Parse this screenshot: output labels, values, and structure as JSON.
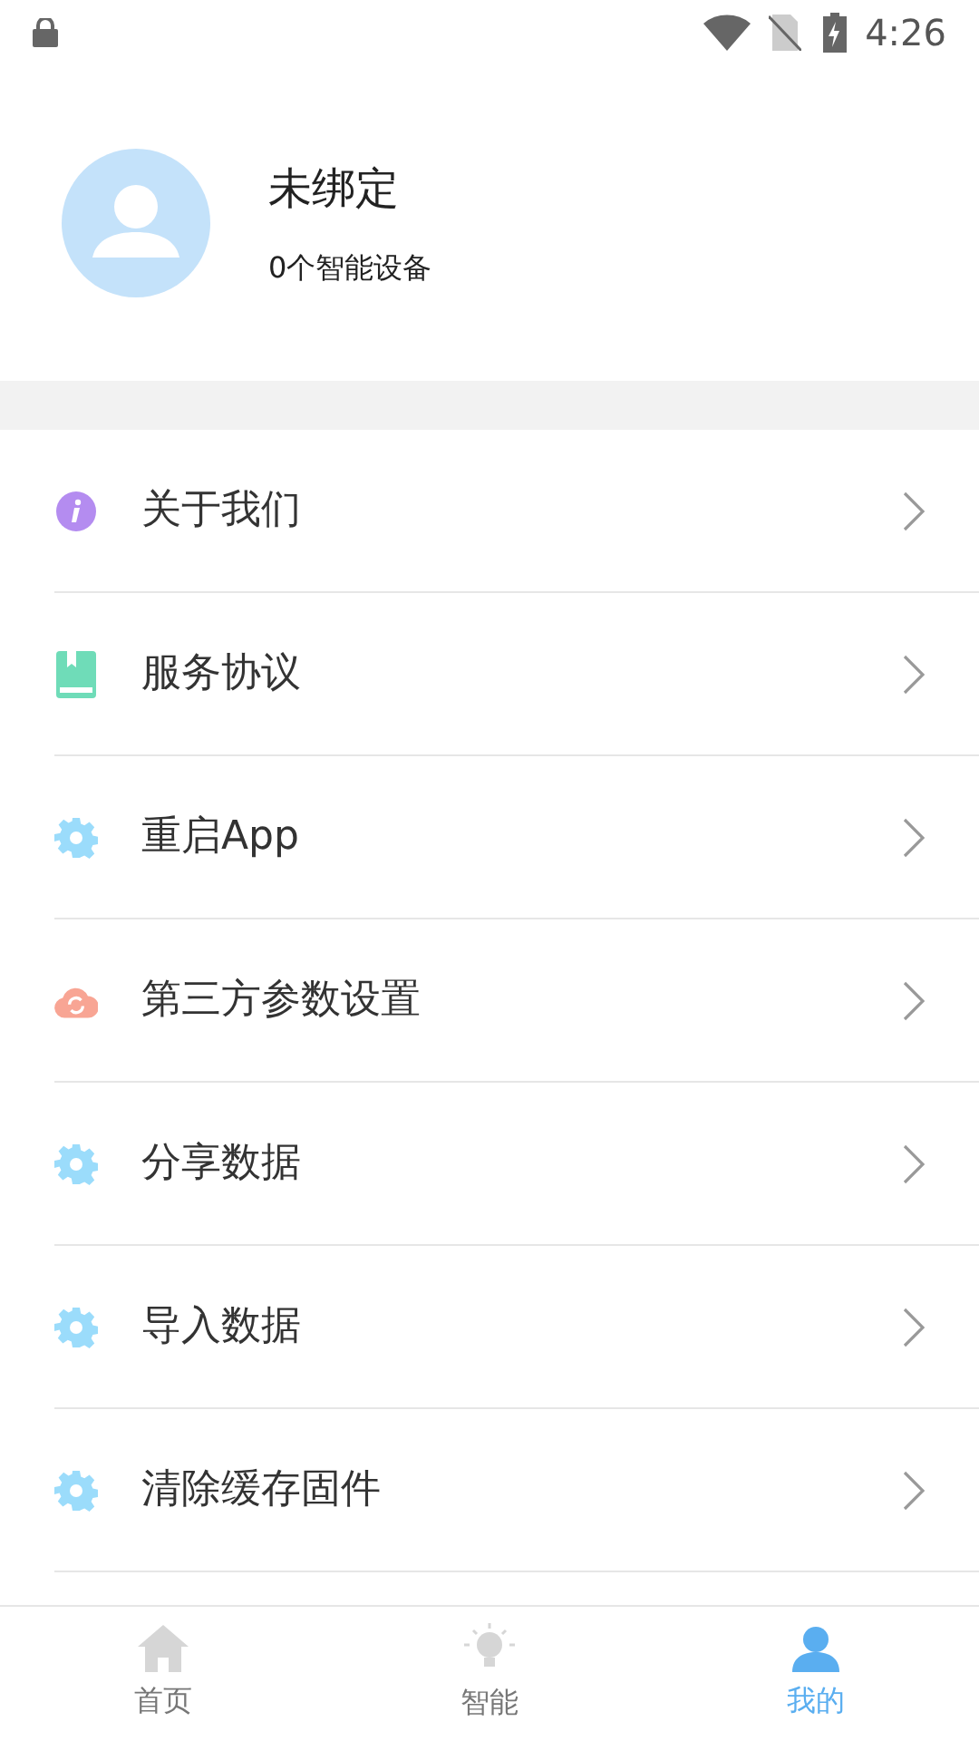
{
  "status_bar": {
    "time": "4:26"
  },
  "profile": {
    "name": "未绑定",
    "subtitle": "0个智能设备"
  },
  "menu": [
    {
      "label": "关于我们",
      "kind": "info"
    },
    {
      "label": "服务协议",
      "kind": "book"
    },
    {
      "label": "重启App",
      "kind": "gear"
    },
    {
      "label": "第三方参数设置",
      "kind": "cloud"
    },
    {
      "label": "分享数据",
      "kind": "gear"
    },
    {
      "label": "导入数据",
      "kind": "gear"
    },
    {
      "label": "清除缓存固件",
      "kind": "gear"
    }
  ],
  "tabs": [
    {
      "label": "首页",
      "kind": "home",
      "selected": false
    },
    {
      "label": "智能",
      "kind": "bulb",
      "selected": false
    },
    {
      "label": "我的",
      "kind": "person",
      "selected": true
    }
  ]
}
